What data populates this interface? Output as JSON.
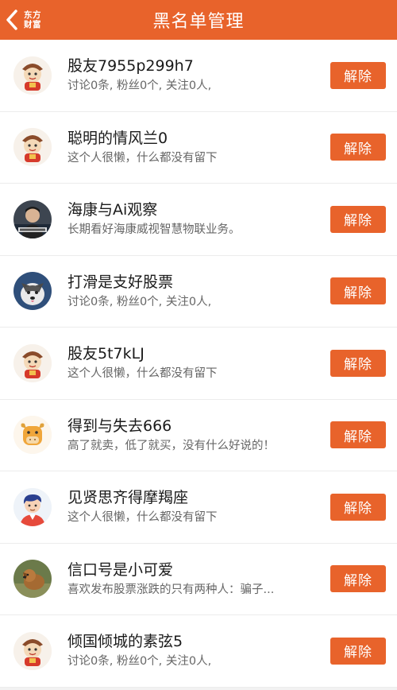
{
  "header": {
    "title": "黑名单管理",
    "brand_line1": "东方",
    "brand_line2": "财富",
    "back_icon": "chevron-left-icon"
  },
  "colors": {
    "accent": "#e8632b"
  },
  "rows": [
    {
      "name": "股友7955p299h7",
      "desc": "讨论0条, 粉丝0个, 关注0人,",
      "button": "解除",
      "avatar": "mascot-avatar"
    },
    {
      "name": "聪明的情风兰0",
      "desc": "这个人很懒，什么都没有留下",
      "button": "解除",
      "avatar": "mascot-avatar"
    },
    {
      "name": "海康与Ai观察",
      "desc": "长期看好海康威视智慧物联业务。",
      "button": "解除",
      "avatar": "photo-man-avatar"
    },
    {
      "name": "打滑是支好股票",
      "desc": "讨论0条, 粉丝0个, 关注0人,",
      "button": "解除",
      "avatar": "husky-dog-avatar"
    },
    {
      "name": "股友5t7kLJ",
      "desc": "这个人很懒，什么都没有留下",
      "button": "解除",
      "avatar": "mascot-avatar"
    },
    {
      "name": "得到与失去666",
      "desc": "高了就卖，低了就买，没有什么好说的！",
      "button": "解除",
      "avatar": "ox-avatar"
    },
    {
      "name": "见贤思齐得摩羯座",
      "desc": "这个人很懒，什么都没有留下",
      "button": "解除",
      "avatar": "cartoon-boy-avatar"
    },
    {
      "name": "信口号是小可爱",
      "desc": "喜欢发布股票涨跌的只有两种人：骗子...",
      "button": "解除",
      "avatar": "dog-photo-avatar"
    },
    {
      "name": "倾国倾城的素弦5",
      "desc": "讨论0条, 粉丝0个, 关注0人,",
      "button": "解除",
      "avatar": "mascot-avatar"
    }
  ]
}
